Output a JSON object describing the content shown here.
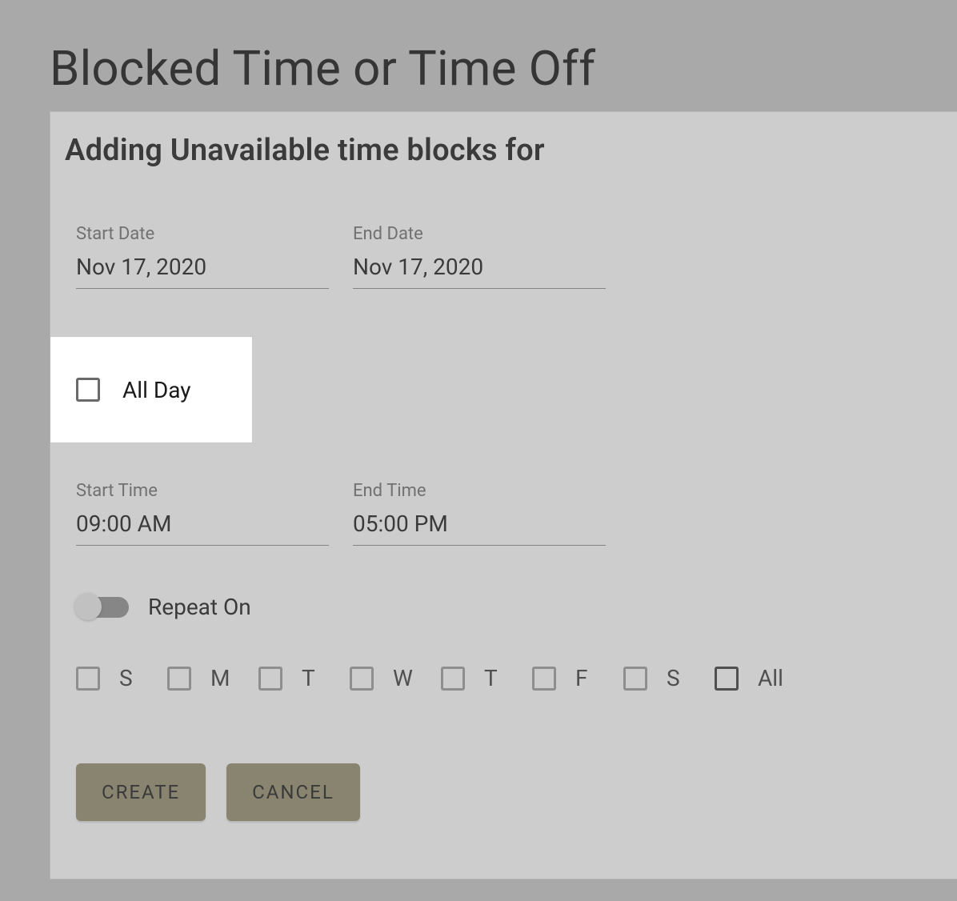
{
  "page": {
    "title": "Blocked Time or Time Off",
    "subtitle": "Adding Unavailable time blocks for"
  },
  "fields": {
    "start_date": {
      "label": "Start Date",
      "value": "Nov 17, 2020"
    },
    "end_date": {
      "label": "End Date",
      "value": "Nov 17, 2020"
    },
    "start_time": {
      "label": "Start Time",
      "value": "09:00 AM"
    },
    "end_time": {
      "label": "End Time",
      "value": "05:00 PM"
    }
  },
  "all_day": {
    "label": "All Day",
    "checked": false
  },
  "repeat": {
    "label": "Repeat On",
    "enabled": false
  },
  "days": {
    "sun": "S",
    "mon": "M",
    "tue": "T",
    "wed": "W",
    "thu": "T",
    "fri": "F",
    "sat": "S",
    "all": "All"
  },
  "buttons": {
    "create": "CREATE",
    "cancel": "CANCEL"
  }
}
